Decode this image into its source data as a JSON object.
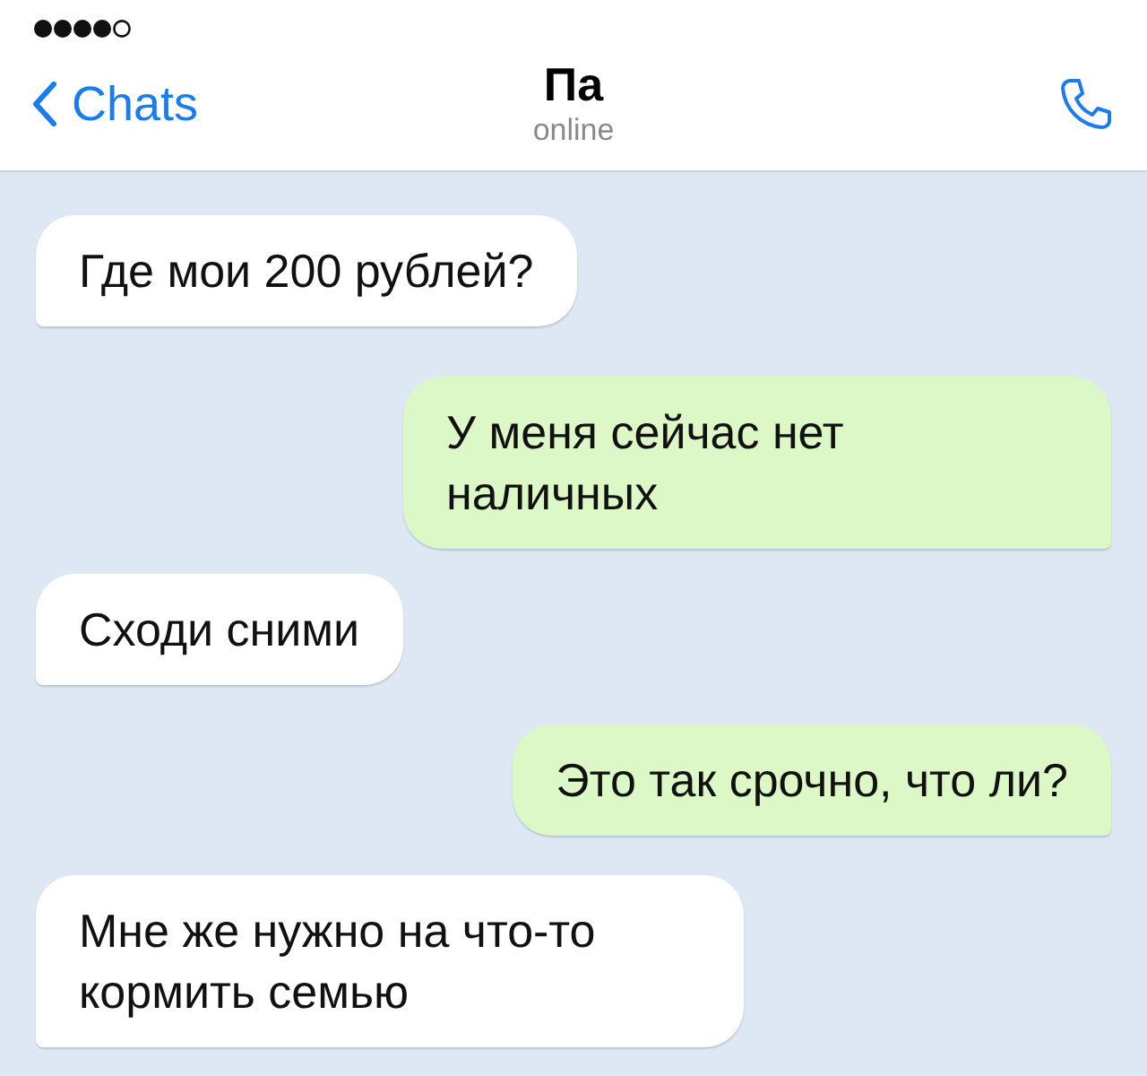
{
  "header": {
    "back_label": "Chats",
    "title": "Па",
    "subtitle": "online"
  },
  "messages": [
    {
      "text": "Где мои 200 рублей?",
      "outgoing": false
    },
    {
      "text": "У меня сейчас нет наличных",
      "outgoing": true
    },
    {
      "text": "Сходи сними",
      "outgoing": false
    },
    {
      "text": "Это так срочно, что ли?",
      "outgoing": true
    },
    {
      "text": "Мне же нужно на что-то кормить семью",
      "outgoing": false
    }
  ]
}
